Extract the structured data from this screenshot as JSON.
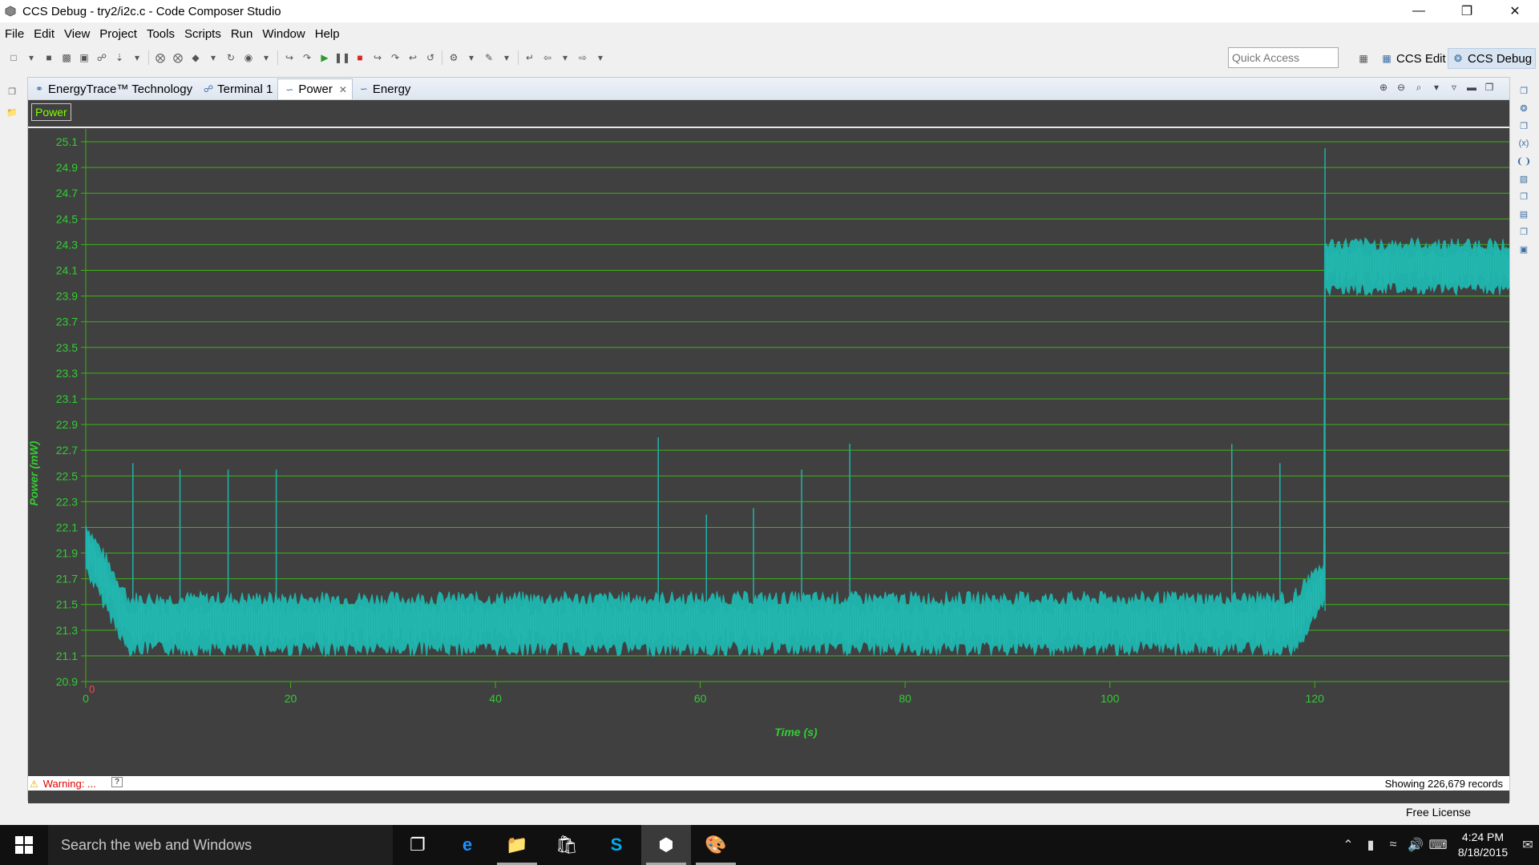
{
  "window": {
    "title": "CCS Debug - try2/i2c.c - Code Composer Studio",
    "controls": [
      "minimize",
      "restore",
      "close"
    ]
  },
  "menu": [
    "File",
    "Edit",
    "View",
    "Project",
    "Tools",
    "Scripts",
    "Run",
    "Window",
    "Help"
  ],
  "toolbar": {
    "quick_access_placeholder": "Quick Access",
    "perspectives": [
      {
        "label": "CCS Edit",
        "active": false
      },
      {
        "label": "CCS Debug",
        "active": true
      }
    ]
  },
  "tabs": [
    {
      "label": "EnergyTrace™ Technology",
      "icon": "energytrace-icon",
      "active": false
    },
    {
      "label": "Terminal 1",
      "icon": "terminal-icon",
      "active": false
    },
    {
      "label": "Power",
      "icon": "chart-icon",
      "active": true
    },
    {
      "label": "Energy",
      "icon": "chart-icon",
      "active": false
    }
  ],
  "plot": {
    "label": "Power",
    "zero_marker": "0",
    "warning_text": "Warning: ...",
    "help_button": "?",
    "records_text": "Showing 226,679 records"
  },
  "chart_data": {
    "type": "line",
    "xlabel": "Time  (s)",
    "ylabel": "Power  (mW)",
    "xlim": [
      0,
      139
    ],
    "ylim": [
      20.9,
      25.2
    ],
    "x_ticks": [
      0,
      20,
      40,
      60,
      80,
      100,
      120
    ],
    "y_ticks": [
      "20.9",
      "21.1",
      "21.3",
      "21.5",
      "21.7",
      "21.9",
      "22.1",
      "22.3",
      "22.5",
      "22.7",
      "22.9",
      "23.1",
      "23.3",
      "23.5",
      "23.7",
      "23.9",
      "24.1",
      "24.3",
      "24.5",
      "24.7",
      "24.9",
      "25.1"
    ],
    "grid": true,
    "background": "#404040",
    "grid_color": "#3cb414",
    "series_color": "#20b2aa",
    "label_color": "#32cd32",
    "segments": [
      {
        "x_start": 0,
        "x_end": 4,
        "band_top_start": 22.1,
        "band_top_end": 21.55,
        "band_bottom_start": 21.8,
        "band_bottom_end": 21.2
      },
      {
        "x_start": 4,
        "x_end": 118,
        "band_top": 21.52,
        "band_bottom": 21.18
      },
      {
        "x_start": 118,
        "x_end": 120.9,
        "band_top_start": 21.55,
        "band_top_end": 21.8,
        "band_bottom_start": 21.15,
        "band_bottom_end": 21.55
      },
      {
        "x_start": 121,
        "x_end": 139,
        "band_top": 24.28,
        "band_bottom": 23.98
      }
    ],
    "spikes": [
      {
        "x": 4.6,
        "y": 22.6
      },
      {
        "x": 9.2,
        "y": 22.55
      },
      {
        "x": 13.9,
        "y": 22.55
      },
      {
        "x": 18.6,
        "y": 22.55
      },
      {
        "x": 55.9,
        "y": 22.8
      },
      {
        "x": 60.6,
        "y": 22.2
      },
      {
        "x": 65.2,
        "y": 22.25
      },
      {
        "x": 69.9,
        "y": 22.55
      },
      {
        "x": 74.6,
        "y": 22.75
      },
      {
        "x": 111.9,
        "y": 22.75
      },
      {
        "x": 116.6,
        "y": 22.6
      },
      {
        "x": 121.0,
        "y": 25.05
      }
    ]
  },
  "status": {
    "license": "Free License"
  },
  "taskbar": {
    "search_placeholder": "Search the web and Windows",
    "apps": [
      "task-view",
      "edge",
      "file-explorer",
      "store",
      "skype",
      "code-composer-studio",
      "paint"
    ],
    "time": "4:24 PM",
    "date": "8/18/2015"
  }
}
